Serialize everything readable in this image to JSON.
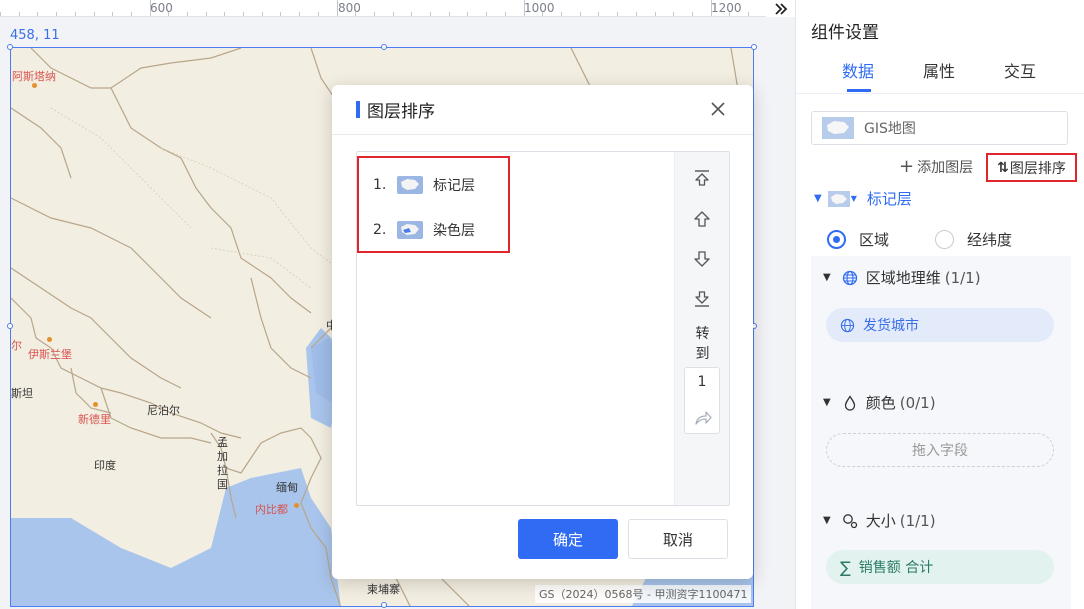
{
  "ruler": {
    "labels": [
      "600",
      "800",
      "1000",
      "1200"
    ],
    "collapse_icon": "double-chevron-right-icon"
  },
  "canvas": {
    "coordinates": "458, 11"
  },
  "map": {
    "labels": {
      "astana": "阿斯塔纳",
      "er": "尔",
      "islamabad": "伊斯兰堡",
      "tan": "斯坦",
      "delhi": "新德里",
      "nepal": "尼泊尔",
      "bangladesh": "孟\n加\n拉\n国",
      "india": "印度",
      "myanmar": "缅甸",
      "naypyidaw": "内比都",
      "cambodia": "柬埔寨",
      "china": "中"
    },
    "copyright": "GS（2024）0568号 - 甲测资字1100471",
    "colors": {
      "land": "#f3eee2",
      "sea": "#a9c5ec",
      "border": "#b8a68a"
    }
  },
  "modal": {
    "title": "图层排序",
    "layers": [
      {
        "num": "1.",
        "name": "标记层"
      },
      {
        "num": "2.",
        "name": "染色层"
      }
    ],
    "tools": {
      "top_icon": "move-to-top-icon",
      "up_icon": "move-up-icon",
      "down_icon": "move-down-icon",
      "bottom_icon": "move-to-bottom-icon",
      "goto_label": "转\n到",
      "goto_value": "1",
      "go_icon": "go-arrow-icon"
    },
    "confirm": "确定",
    "cancel": "取消"
  },
  "panel": {
    "title": "组件设置",
    "tabs": [
      {
        "label": "数据",
        "active": true
      },
      {
        "label": "属性",
        "active": false
      },
      {
        "label": "交互",
        "active": false
      }
    ],
    "gis_label": "GIS地图",
    "add_layer": "添加图层",
    "sort_layer": "图层排序",
    "layer_name": "标记层",
    "radio": [
      {
        "label": "区域",
        "checked": true
      },
      {
        "label": "经纬度",
        "checked": false
      }
    ],
    "sections": {
      "region": {
        "title": "区域地理维",
        "count": "(1/1)",
        "field": "发货城市"
      },
      "color": {
        "title": "颜色",
        "count": "(0/1)",
        "placeholder": "拖入字段"
      },
      "size": {
        "title": "大小",
        "count": "(1/1)",
        "field": "销售额 合计"
      }
    },
    "accent_color": "#2f6bf3",
    "highlight_color": "#e0252b"
  }
}
